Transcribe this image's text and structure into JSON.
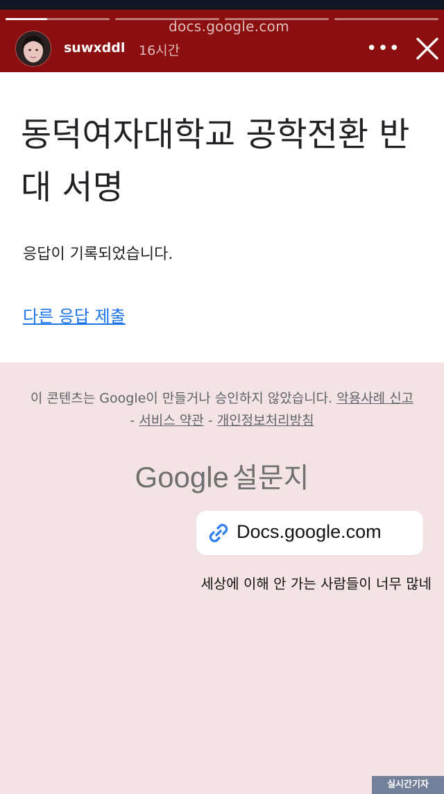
{
  "story": {
    "url": "docs.google.com",
    "username": "suwxddl",
    "timestamp": "16시간",
    "more_label": "•••",
    "progress": [
      0.4,
      0,
      0,
      0,
      0
    ]
  },
  "form": {
    "title": "동덕여자대학교 공학전환 반대 서명",
    "message": "응답이 기록되었습니다.",
    "resubmit_link": "다른 응답 제출"
  },
  "footer": {
    "disclaimer_text": "이 콘텐츠는 Google이 만들거나 승인하지 않았습니다. ",
    "report_link": "악용사례 신고",
    "separator": " - ",
    "terms_link": "서비스 약관",
    "privacy_link": "개인정보처리방침",
    "brand_google": "Google",
    "brand_forms": "설문지"
  },
  "sticker": {
    "icon": "link-icon",
    "text": "Docs.google.com",
    "accent": "#2f80ed"
  },
  "caption": "세상에 이해 안 가는 사람들이 너무 많네",
  "watermark": "실시간기자",
  "colors": {
    "header": "#8c0f0f",
    "link": "#1a73e8",
    "background": "#f3e3e4"
  }
}
